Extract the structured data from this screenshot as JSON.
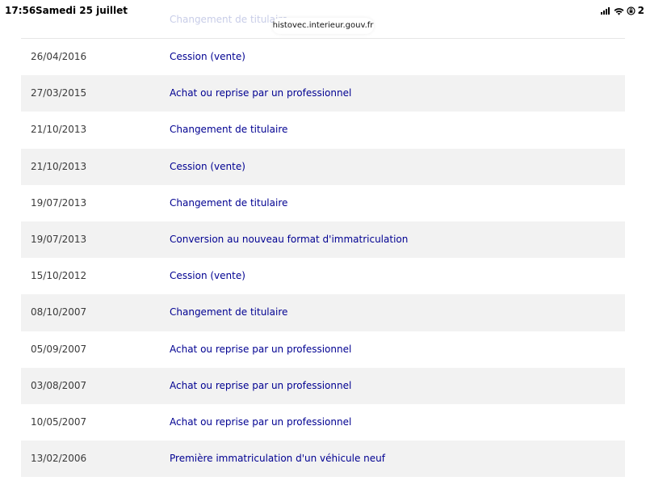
{
  "status_bar": {
    "time": "17:56",
    "date": "Samedi 25 juillet",
    "battery": "2",
    "icons": [
      "signal-icon",
      "wifi-icon",
      "orientation-lock-icon"
    ]
  },
  "browser": {
    "url": "histovec.interieur.gouv.fr"
  },
  "colors": {
    "link": "#000091",
    "row_alt_bg": "#f2f2f2",
    "date_text": "#3a3a3a"
  },
  "history": {
    "partial_row": {
      "event": "Changement de titulaire"
    },
    "rows": [
      {
        "date": "26/04/2016",
        "event": "Cession (vente)"
      },
      {
        "date": "27/03/2015",
        "event": "Achat ou reprise par un professionnel"
      },
      {
        "date": "21/10/2013",
        "event": "Changement de titulaire"
      },
      {
        "date": "21/10/2013",
        "event": "Cession (vente)"
      },
      {
        "date": "19/07/2013",
        "event": "Changement de titulaire"
      },
      {
        "date": "19/07/2013",
        "event": "Conversion au nouveau format d'immatriculation"
      },
      {
        "date": "15/10/2012",
        "event": "Cession (vente)"
      },
      {
        "date": "08/10/2007",
        "event": "Changement de titulaire"
      },
      {
        "date": "05/09/2007",
        "event": "Achat ou reprise par un professionnel"
      },
      {
        "date": "03/08/2007",
        "event": "Achat ou reprise par un professionnel"
      },
      {
        "date": "10/05/2007",
        "event": "Achat ou reprise par un professionnel"
      },
      {
        "date": "13/02/2006",
        "event": "Première immatriculation d'un véhicule neuf"
      }
    ]
  }
}
